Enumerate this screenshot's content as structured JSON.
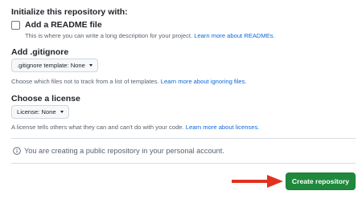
{
  "init_section": {
    "heading": "Initialize this repository with:",
    "readme": {
      "checked": false,
      "label": "Add a README file",
      "help": "This is where you can write a long description for your project.",
      "link": "Learn more about READMEs."
    }
  },
  "gitignore": {
    "heading": "Add .gitignore",
    "select_label": ".gitignore template: None",
    "help": "Choose which files not to track from a list of templates.",
    "link": "Learn more about ignoring files."
  },
  "license": {
    "heading": "Choose a license",
    "select_label": "License: None",
    "help": "A license tells others what they can and can't do with your code.",
    "link": "Learn more about licenses."
  },
  "notice": {
    "icon": "info-icon",
    "text": "You are creating a public repository in your personal account."
  },
  "arrow": {
    "icon": "arrow-right-icon",
    "color": "#e0321c"
  },
  "create_button": {
    "label": "Create repository",
    "color": "#1f883d"
  }
}
